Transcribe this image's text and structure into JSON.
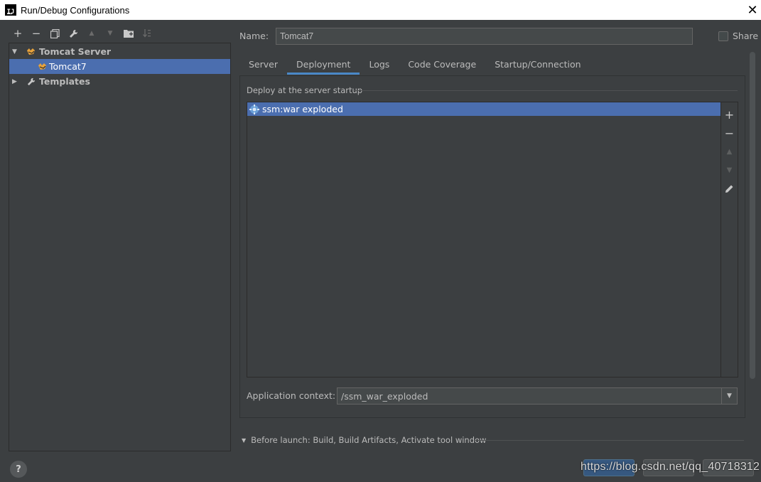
{
  "window": {
    "title": "Run/Debug Configurations",
    "logo": "IJ"
  },
  "toolbar": {
    "add": "+",
    "remove": "−",
    "copy": "⧉",
    "edit": "🔧",
    "up": "▲",
    "down": "▼",
    "folder": "📁",
    "sort": "↓"
  },
  "tree": {
    "items": [
      {
        "label": "Tomcat Server",
        "expanded": true
      },
      {
        "label": "Tomcat7",
        "selected": true
      },
      {
        "label": "Templates",
        "expanded": false
      }
    ]
  },
  "config": {
    "name_label": "Name:",
    "name_value": "Tomcat7",
    "share_label": "Share",
    "share_checked": false
  },
  "tabs": [
    {
      "label": "Server"
    },
    {
      "label": "Deployment",
      "active": true
    },
    {
      "label": "Logs"
    },
    {
      "label": "Code Coverage"
    },
    {
      "label": "Startup/Connection"
    }
  ],
  "deployment": {
    "section_title": "Deploy at the server startup",
    "items": [
      {
        "label": "ssm:war exploded",
        "selected": true
      }
    ],
    "context_label": "Application context:",
    "context_value": "/ssm_war_exploded"
  },
  "before_launch": {
    "label": "Before launch: Build, Build Artifacts, Activate tool window"
  },
  "footer": {
    "help": "?",
    "watermark": "https://blog.csdn.net/qq_40718312"
  },
  "colors": {
    "background": "#3c3f41",
    "selection": "#4b6eaf",
    "tab_underline": "#4a88c7"
  }
}
